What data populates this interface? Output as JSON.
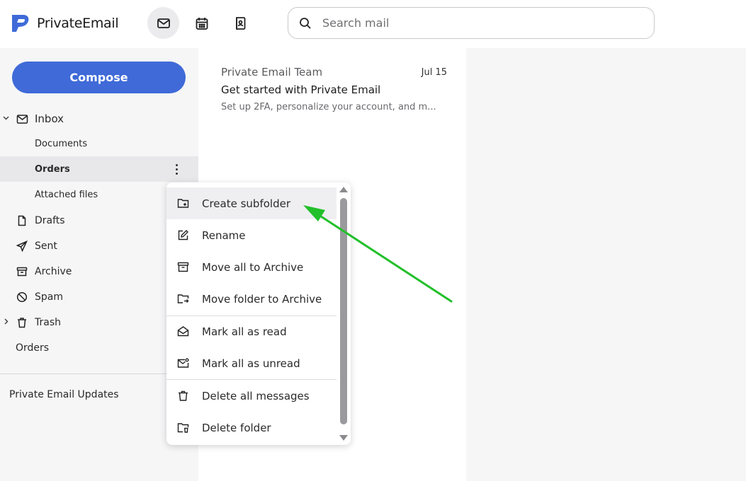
{
  "app": {
    "name": "PrivateEmail",
    "brand_color": "#3f6ad8"
  },
  "header": {
    "nav": [
      {
        "icon": "mail-icon",
        "active": true
      },
      {
        "icon": "calendar-icon",
        "active": false
      },
      {
        "icon": "contacts-icon",
        "active": false
      }
    ],
    "search": {
      "placeholder": "Search mail",
      "value": ""
    }
  },
  "sidebar": {
    "compose_label": "Compose",
    "folders": [
      {
        "label": "Inbox",
        "icon": "mail-icon",
        "expanded": true
      },
      {
        "label": "Documents"
      },
      {
        "label": "Orders",
        "selected": true
      },
      {
        "label": "Attached files"
      },
      {
        "label": "Drafts",
        "icon": "draft-icon"
      },
      {
        "label": "Sent",
        "icon": "send-icon"
      },
      {
        "label": "Archive",
        "icon": "archive-icon"
      },
      {
        "label": "Spam",
        "icon": "spam-icon"
      },
      {
        "label": "Trash",
        "icon": "trash-icon",
        "expanded": false
      },
      {
        "label": "Orders"
      }
    ],
    "shared": {
      "label": "Private Email Updates"
    }
  },
  "messages": [
    {
      "sender": "Private Email Team",
      "date": "Jul 15",
      "subject": "Get started with Private Email",
      "preview": "Set up 2FA, personalize your account, and m..."
    }
  ],
  "context_menu": {
    "items": [
      {
        "label": "Create subfolder",
        "icon": "folder-plus-icon",
        "highlighted": true
      },
      {
        "label": "Rename",
        "icon": "edit-icon"
      },
      {
        "label": "Move all to Archive",
        "icon": "archive-icon"
      },
      {
        "label": "Move folder to Archive",
        "icon": "folder-move-icon"
      },
      {
        "label": "Mark all as read",
        "icon": "mail-open-icon"
      },
      {
        "label": "Mark all as unread",
        "icon": "mail-unread-icon"
      },
      {
        "label": "Delete all messages",
        "icon": "trash-icon"
      },
      {
        "label": "Delete folder",
        "icon": "folder-delete-icon"
      }
    ]
  },
  "annotation": {
    "color": "#22c02a"
  }
}
